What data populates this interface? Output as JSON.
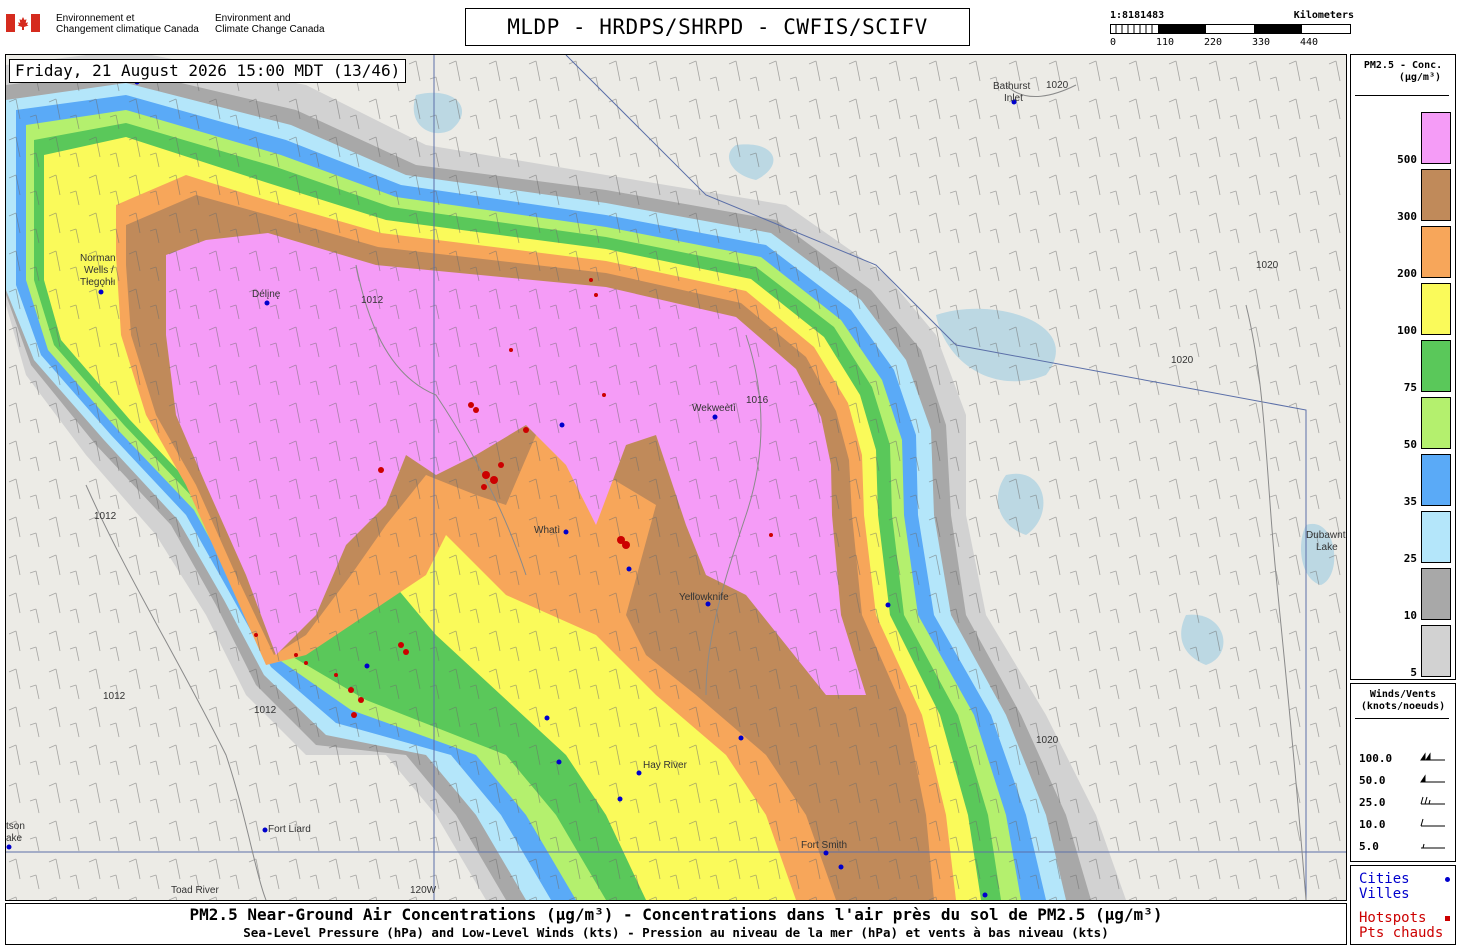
{
  "header": {
    "agency_fr_line1": "Environnement et",
    "agency_fr_line2": "Changement climatique Canada",
    "agency_en_line1": "Environment and",
    "agency_en_line2": "Climate Change Canada",
    "title": "MLDP - HRDPS/SHRPD - CWFIS/SCIFV"
  },
  "scale": {
    "ratio": "1:8181483",
    "unit": "Kilometers",
    "ticks": [
      "0",
      "110",
      "220",
      "330",
      "440"
    ]
  },
  "timestamp": "Friday, 21 August 2026 15:00 MDT (13/46)",
  "legend_pm": {
    "title_line1": "PM2.5 - Conc.",
    "title_line2": "(µg/m³)",
    "levels": [
      {
        "label": "500",
        "color": "#f59cf7"
      },
      {
        "label": "300",
        "color": "#c08a5a"
      },
      {
        "label": "200",
        "color": "#f7a65a"
      },
      {
        "label": "100",
        "color": "#fafa5a"
      },
      {
        "label": "75",
        "color": "#5ac85a"
      },
      {
        "label": "50",
        "color": "#b4f06e"
      },
      {
        "label": "35",
        "color": "#5aaaf7"
      },
      {
        "label": "25",
        "color": "#b4e6fa"
      },
      {
        "label": "10",
        "color": "#a8a8a8"
      },
      {
        "label": "5",
        "color": "#d2d2d2"
      }
    ]
  },
  "legend_wind": {
    "title_line1": "Winds/Vents",
    "title_line2": "(knots/noeuds)",
    "rows": [
      "100.0",
      "50.0",
      "25.0",
      "10.0",
      "5.0"
    ]
  },
  "legend_points": {
    "cities_en": "Cities",
    "cities_fr": "Villes",
    "hotspots_en": "Hotspots",
    "hotspots_fr": "Pts chauds",
    "city_color": "#0000cc",
    "hotspot_color": "#cc0000"
  },
  "footer": {
    "line1": "PM2.5 Near-Ground Air Concentrations (µg/m³) - Concentrations dans l'air près du sol de PM2.5 (µg/m³)",
    "line2": "Sea-Level Pressure (hPa) and Low-Level Winds (kts) - Pression au niveau de la mer (hPa) et vents à bas niveau (kts)"
  },
  "map_labels": {
    "bathurst": "Bathurst",
    "inlet": "Inlet",
    "norman1": "Norman",
    "norman2": "Wells /",
    "norman3": "Tłegǫhłı",
    "deline": "Délįnę",
    "wekweeti": "Wekweètì",
    "whati": "Whatì",
    "yellowknife": "Yellowknife",
    "hay_river": "Hay River",
    "fort_smith": "Fort Smith",
    "fort_liard": "Fort Liard",
    "toad_river": "Toad River",
    "watson1": "tson",
    "watson2": "ake",
    "dubawnt1": "Dubawnt",
    "dubawnt2": "Lake",
    "meridian": "120W",
    "p1012": "1012",
    "p1016": "1016",
    "p1020": "1020"
  }
}
